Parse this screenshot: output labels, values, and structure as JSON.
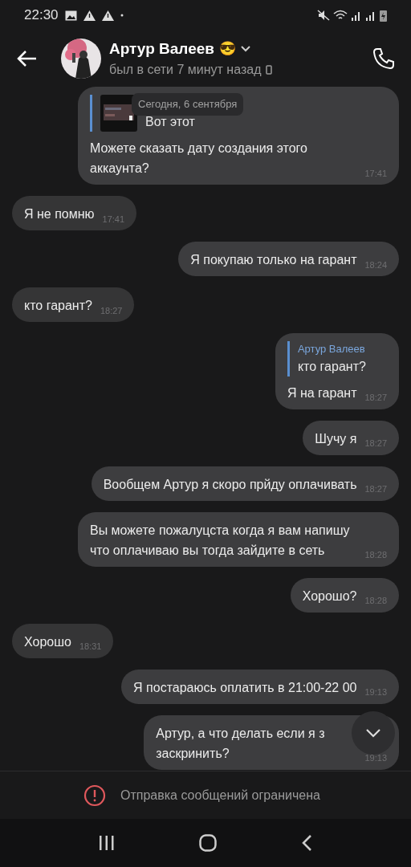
{
  "status_bar": {
    "time": "22:30"
  },
  "header": {
    "name": "Артур Валеев",
    "emoji": "😎",
    "status": "был в сети 7 минут назад"
  },
  "date_pill": "Сегодня, 6 сентября",
  "messages": [
    {
      "outgoing": true,
      "reply": {
        "text": "Вот этот",
        "thumbnail": true
      },
      "text": "Можете сказать дату создания этого аккаунта?",
      "time": "17:41"
    },
    {
      "outgoing": false,
      "text": "Я не помню",
      "time": "17:41"
    },
    {
      "outgoing": true,
      "text": "Я покупаю только на гарант",
      "time": "18:24"
    },
    {
      "outgoing": false,
      "text": "кто гарант?",
      "time": "18:27"
    },
    {
      "outgoing": true,
      "reply": {
        "author": "Артур Валеев",
        "text": "кто гарант?"
      },
      "text": "Я на гарант",
      "time": "18:27"
    },
    {
      "outgoing": true,
      "text": "Шучу я",
      "time": "18:27"
    },
    {
      "outgoing": true,
      "text": "Вообщем Артур я скоро прйду оплачивать",
      "time": "18:27"
    },
    {
      "outgoing": true,
      "text": "Вы можете пожалуцста когда я вам напишу что оплачиваю вы тогда зайдите в сеть",
      "time": "18:28"
    },
    {
      "outgoing": true,
      "text": "Хорошо?",
      "time": "18:28"
    },
    {
      "outgoing": false,
      "text": "Хорошо",
      "time": "18:31"
    },
    {
      "outgoing": true,
      "text": "Я постараюсь оплатить в 21:00-22 00",
      "time": "19:13"
    },
    {
      "outgoing": true,
      "text": "Артур, а что делать если я з\nзаскринить?",
      "time": "19:13"
    }
  ],
  "restriction": "Отправка сообщений ограничена"
}
